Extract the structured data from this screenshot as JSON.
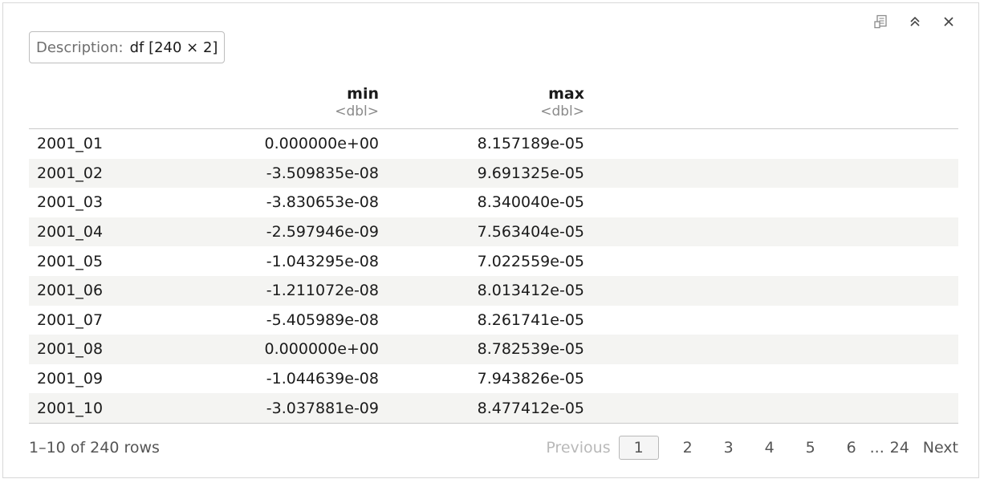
{
  "toolbar": {
    "icons": [
      "open-in-viewer-icon",
      "collapse-icon",
      "close-icon"
    ]
  },
  "description": {
    "label": "Description:",
    "value": "df [240 × 2]"
  },
  "table": {
    "columns": [
      {
        "name": "min",
        "type": "<dbl>"
      },
      {
        "name": "max",
        "type": "<dbl>"
      }
    ],
    "rows": [
      {
        "name": "2001_01",
        "min": "0.000000e+00",
        "max": "8.157189e-05"
      },
      {
        "name": "2001_02",
        "min": "-3.509835e-08",
        "max": "9.691325e-05"
      },
      {
        "name": "2001_03",
        "min": "-3.830653e-08",
        "max": "8.340040e-05"
      },
      {
        "name": "2001_04",
        "min": "-2.597946e-09",
        "max": "7.563404e-05"
      },
      {
        "name": "2001_05",
        "min": "-1.043295e-08",
        "max": "7.022559e-05"
      },
      {
        "name": "2001_06",
        "min": "-1.211072e-08",
        "max": "8.013412e-05"
      },
      {
        "name": "2001_07",
        "min": "-5.405989e-08",
        "max": "8.261741e-05"
      },
      {
        "name": "2001_08",
        "min": "0.000000e+00",
        "max": "8.782539e-05"
      },
      {
        "name": "2001_09",
        "min": "-1.044639e-08",
        "max": "7.943826e-05"
      },
      {
        "name": "2001_10",
        "min": "-3.037881e-09",
        "max": "8.477412e-05"
      }
    ]
  },
  "footer": {
    "row_count": "1–10 of 240 rows",
    "previous": "Previous",
    "pages": [
      "1",
      "2",
      "3",
      "4",
      "5",
      "6"
    ],
    "ellipsis": "...",
    "last_page": "24",
    "next": "Next"
  }
}
